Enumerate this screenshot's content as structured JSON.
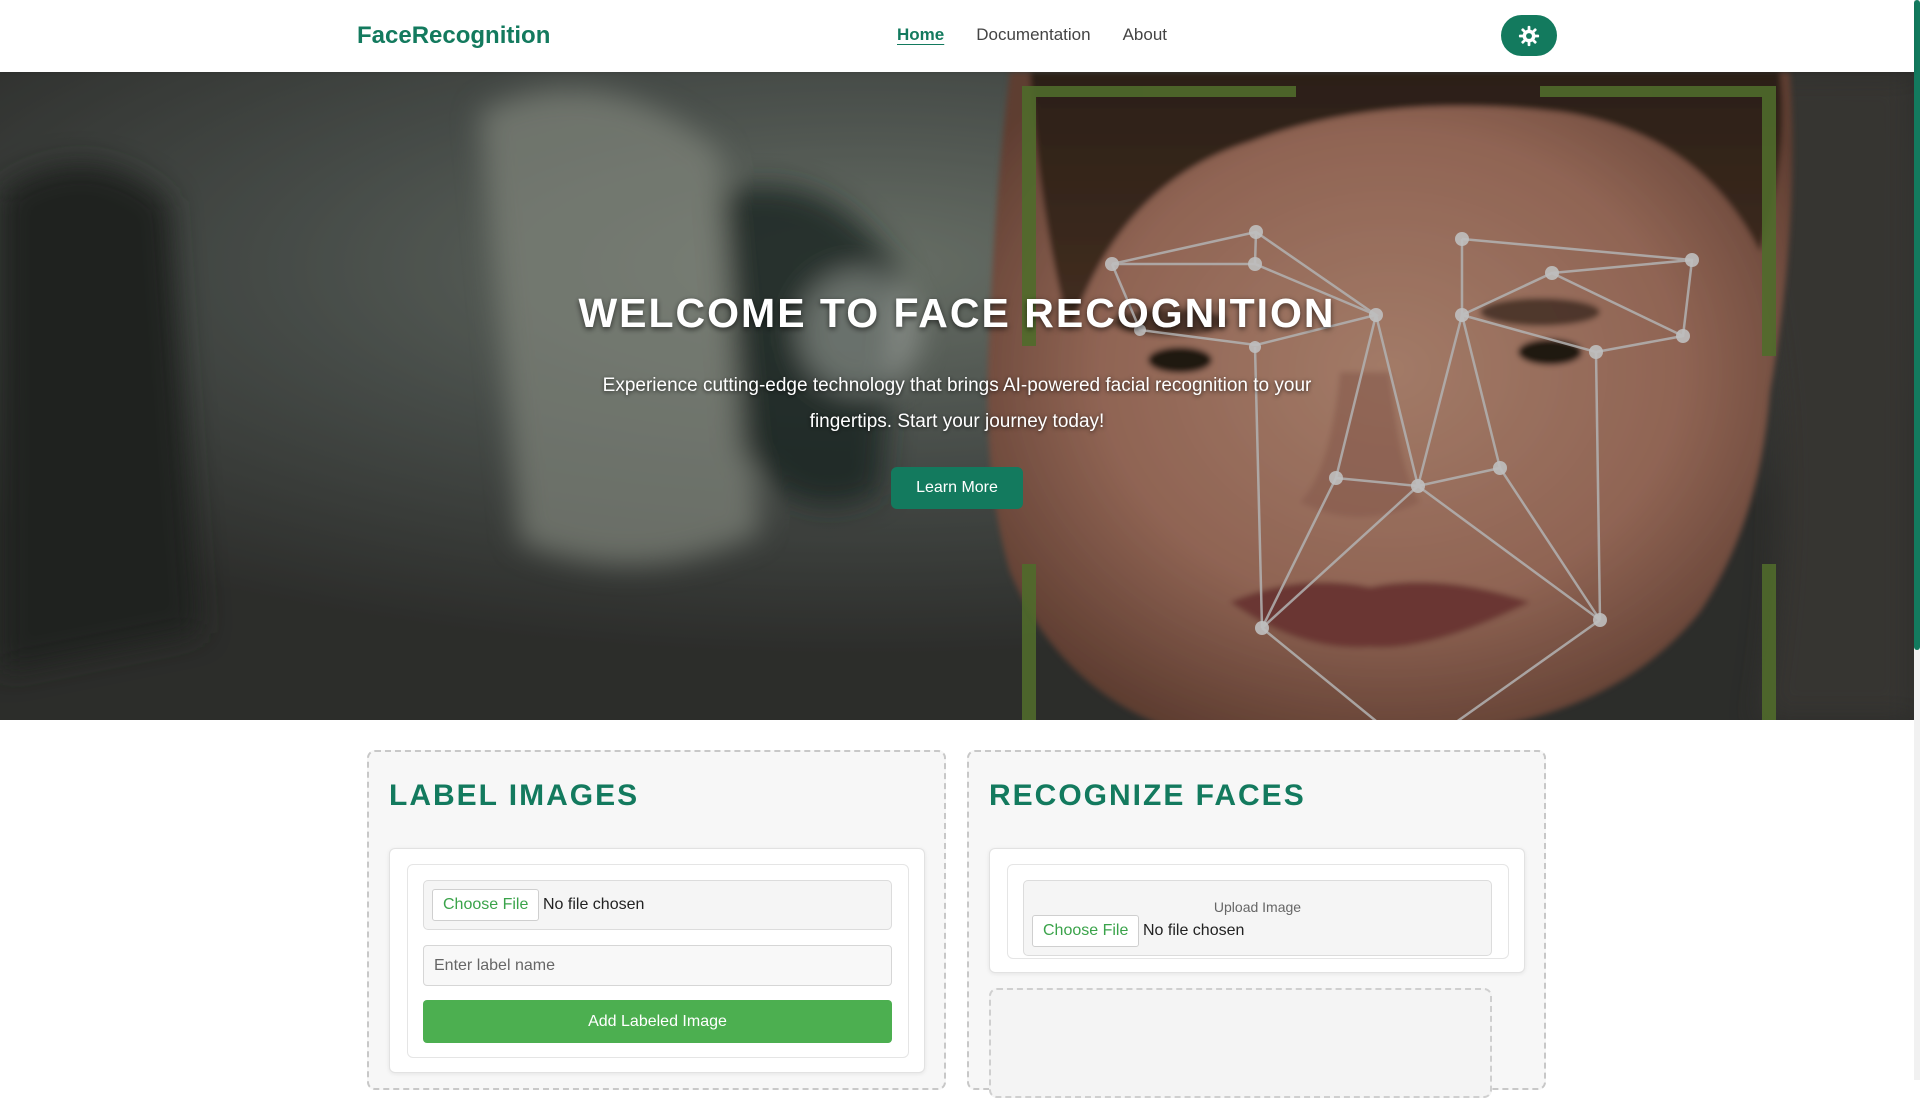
{
  "header": {
    "logo": "FaceRecognition",
    "nav": [
      {
        "label": "Home",
        "active": true
      },
      {
        "label": "Documentation",
        "active": false
      },
      {
        "label": "About",
        "active": false
      }
    ],
    "settings_icon": "gear-icon"
  },
  "hero": {
    "title": "WELCOME TO FACE RECOGNITION",
    "subtitle": "Experience cutting-edge technology that brings AI-powered facial recognition to your fingertips. Start your journey today!",
    "button_label": "Learn More"
  },
  "label_card": {
    "title": "LABEL IMAGES",
    "choose_file_label": "Choose File",
    "file_status": "No file chosen",
    "label_placeholder": "Enter label name",
    "add_button_label": "Add Labeled Image"
  },
  "recognize_card": {
    "title": "RECOGNIZE FACES",
    "upload_label": "Upload Image",
    "choose_file_label": "Choose File",
    "file_status": "No file chosen"
  },
  "colors": {
    "brand": "#137a5e",
    "button_green": "#4caf50",
    "frame_green": "#6a8f3a"
  }
}
